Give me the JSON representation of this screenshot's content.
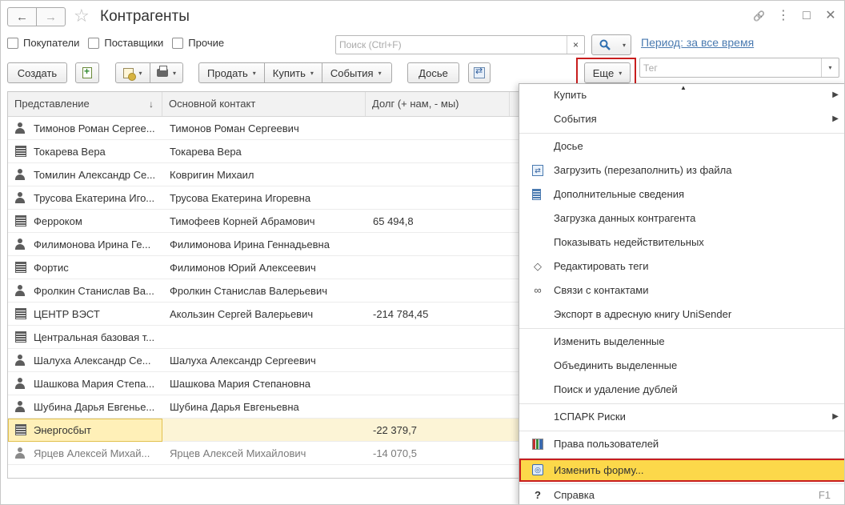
{
  "window": {
    "title": "Контрагенты",
    "back_icon": "←",
    "forward_icon": "→",
    "star_icon": "☆",
    "link_icon": "🔗",
    "menu_icon": "⋮",
    "maximize_icon": "□",
    "close_icon": "✕"
  },
  "filters": {
    "buyers": "Покупатели",
    "suppliers": "Поставщики",
    "other": "Прочие"
  },
  "search": {
    "placeholder": "Поиск (Ctrl+F)",
    "clear_icon": "×",
    "search_icon": "🔍",
    "dropdown": "▾"
  },
  "period": "Период: за все время",
  "toolbar": {
    "create": "Создать",
    "caret": "▾",
    "sell": "Продать",
    "buy": "Купить",
    "events": "События",
    "dossier": "Досье",
    "more": "Еще",
    "tag_placeholder": "Тег"
  },
  "table": {
    "columns": [
      "Представление",
      "Основной контакт",
      "Долг (+ нам, - мы)"
    ],
    "sort_icon": "↓",
    "rows": [
      {
        "type": "person",
        "name": "Тимонов Роман Сергее...",
        "contact": "Тимонов Роман Сергеевич",
        "debt": ""
      },
      {
        "type": "org",
        "name": "Токарева Вера",
        "contact": "Токарева Вера",
        "debt": ""
      },
      {
        "type": "person",
        "name": "Томилин Александр Се...",
        "contact": "Ковригин Михаил",
        "debt": ""
      },
      {
        "type": "person",
        "name": "Трусова Екатерина Иго...",
        "contact": "Трусова Екатерина Игоревна",
        "debt": ""
      },
      {
        "type": "org",
        "name": "Ферроком",
        "contact": "Тимофеев Корней Абрамович",
        "debt": "65 494,8"
      },
      {
        "type": "person",
        "name": "Филимонова Ирина Ге...",
        "contact": "Филимонова Ирина Геннадьевна",
        "debt": ""
      },
      {
        "type": "org",
        "name": "Фортис",
        "contact": "Филимонов Юрий Алексеевич",
        "debt": ""
      },
      {
        "type": "person",
        "name": "Фролкин Станислав Ва...",
        "contact": "Фролкин Станислав Валерьевич",
        "debt": ""
      },
      {
        "type": "org",
        "name": "ЦЕНТР ВЭСТ",
        "contact": "Акользин Сергей Валерьевич",
        "debt": "-214 784,45"
      },
      {
        "type": "org",
        "name": "Центральная базовая т...",
        "contact": "",
        "debt": ""
      },
      {
        "type": "person",
        "name": "Шалуха Александр Се...",
        "contact": "Шалуха Александр Сергеевич",
        "debt": ""
      },
      {
        "type": "person",
        "name": "Шашкова Мария Степа...",
        "contact": "Шашкова Мария Степановна",
        "debt": ""
      },
      {
        "type": "person",
        "name": "Шубина Дарья Евгенье...",
        "contact": "Шубина Дарья Евгеньевна",
        "debt": ""
      },
      {
        "type": "org",
        "name": "Энергосбыт",
        "contact": "",
        "debt": "-22 379,7",
        "selected": true
      },
      {
        "type": "person",
        "name": "Ярцев Алексей Михай...",
        "contact": "Ярцев Алексей Михайлович",
        "debt": "-14 070,5",
        "muted": true
      }
    ]
  },
  "menu": {
    "notch": "▲",
    "arrow": "▶",
    "items": {
      "buy": "Купить",
      "events": "События",
      "dossier": "Досье",
      "load_file": "Загрузить (перезаполнить) из файла",
      "extra_info": "Дополнительные сведения",
      "load_data": "Загрузка данных контрагента",
      "show_inactive": "Показывать недействительных",
      "edit_tags": "Редактировать теги",
      "contacts": "Связи с контактами",
      "export": "Экспорт в адресную книгу UniSender",
      "change_selected": "Изменить выделенные",
      "merge_selected": "Объединить выделенные",
      "dedupe": "Поиск и удаление дублей",
      "spark": "1СПАРК Риски",
      "rights": "Права пользователей",
      "change_form": "Изменить форму...",
      "help": "Справка",
      "help_key": "F1"
    },
    "icons": {
      "load_file": "⇄",
      "tag": "◇",
      "link": "∞",
      "form": "◎",
      "help": "?"
    }
  },
  "colors": {
    "accent_link": "#4a7ab0",
    "highlight_red": "#c81e1e",
    "menu_active": "#fcd84a",
    "row_selected": "#fcf4d6"
  }
}
